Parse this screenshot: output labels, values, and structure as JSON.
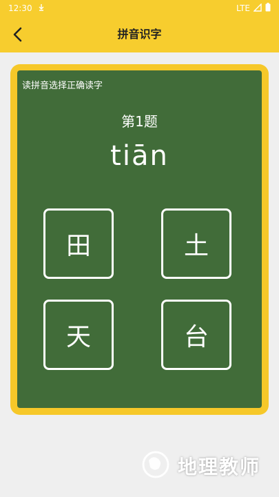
{
  "status_bar": {
    "time": "12:30",
    "network": "LTE"
  },
  "header": {
    "title": "拼音识字"
  },
  "board": {
    "instruction": "读拼音选择正确读字",
    "question_number": "第1题",
    "pinyin": "tiān",
    "options": [
      "田",
      "土",
      "天",
      "台"
    ]
  },
  "watermark": {
    "text": "地理教师"
  },
  "colors": {
    "accent": "#f7cd2e",
    "board": "#416c39",
    "background": "#efefef"
  },
  "icons": {
    "back": "back-arrow-icon"
  }
}
